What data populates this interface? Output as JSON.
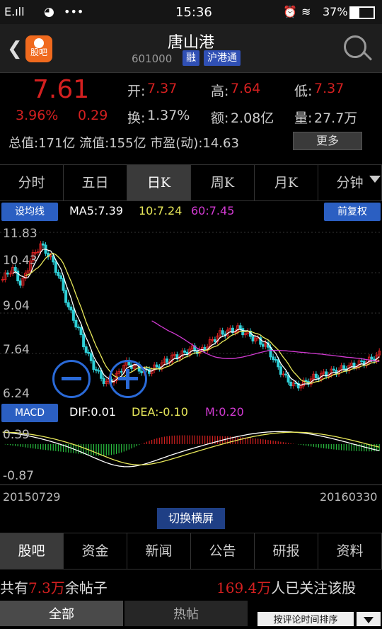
{
  "status": {
    "signal": "E.ıll",
    "time": "15:36",
    "battery": "37%",
    "apps": "•••"
  },
  "header": {
    "title": "唐山港",
    "code": "601000",
    "badge_margin": "融",
    "badge_connect": "沪港通",
    "logo_text": "股吧"
  },
  "quote": {
    "price": "7.61",
    "change_pct": "3.96%",
    "change": "0.29",
    "open_label": "开:",
    "open": "7.37",
    "high_label": "高:",
    "high": "7.64",
    "low_label": "低:",
    "low": "7.37",
    "turnover_label": "换:",
    "turnover": "1.37%",
    "amount_label": "额:",
    "amount": "2.08亿",
    "volume_label": "量:",
    "volume": "27.7万",
    "cap_line": "总值:171亿 流值:155亿 市盈(动):14.63",
    "more": "更多"
  },
  "tabs": [
    "分时",
    "五日",
    "日K",
    "周K",
    "月K",
    "分钟"
  ],
  "active_tab": 2,
  "chart": {
    "btn_left": "设均线",
    "btn_right": "前复权",
    "ma5": "MA5:7.39",
    "ma10": "10:7.24",
    "ma60": "60:7.45",
    "yticks": [
      "11.83",
      "10.43",
      "9.04",
      "7.64",
      "6.24"
    ],
    "macd_label": "MACD",
    "dif": "DIF:0.01",
    "dea": "DEA:-0.10",
    "m": "M:0.20",
    "macd_hi": "0.39",
    "macd_lo": "-0.87",
    "date_start": "20150729",
    "date_end": "20160330",
    "switch": "切换横屏"
  },
  "chart_data": {
    "type": "candlestick",
    "x_range": [
      "20150729",
      "20160330"
    ],
    "ylim": [
      6.24,
      11.83
    ],
    "close": [
      10.2,
      10.6,
      10.0,
      10.9,
      11.4,
      11.0,
      10.3,
      9.2,
      8.5,
      7.6,
      7.0,
      6.6,
      6.8,
      7.3,
      7.2,
      7.0,
      7.1,
      7.3,
      7.5,
      7.6,
      7.8,
      7.7,
      8.0,
      8.3,
      8.4,
      8.5,
      8.3,
      8.1,
      7.9,
      7.3,
      6.8,
      6.5,
      6.6,
      6.8,
      6.9,
      7.0,
      7.1,
      7.2,
      7.3,
      7.4,
      7.61
    ],
    "ma5": 7.39,
    "ma10": 7.24,
    "ma60": 7.45,
    "macd": {
      "dif": 0.01,
      "dea": -0.1,
      "m": 0.2,
      "ylim": [
        -0.87,
        0.39
      ]
    }
  },
  "bottom_tabs": [
    "股吧",
    "资金",
    "新闻",
    "公告",
    "研报",
    "资料"
  ],
  "footer": {
    "posts_prefix": "共有",
    "posts_value": "7.3万",
    "posts_suffix": "余帖子",
    "followers_value": "169.4万",
    "followers_suffix": "人已关注该股"
  },
  "subtabs": {
    "all": "全部",
    "hot": "热帖",
    "sort": "按评论时间排序"
  },
  "colors": {
    "up": "#d42020",
    "down": "#2fd0d8",
    "ma5": "#ffffff",
    "ma10": "#e8e85a",
    "ma60": "#d23ad2",
    "accent": "#2b5fc2"
  }
}
